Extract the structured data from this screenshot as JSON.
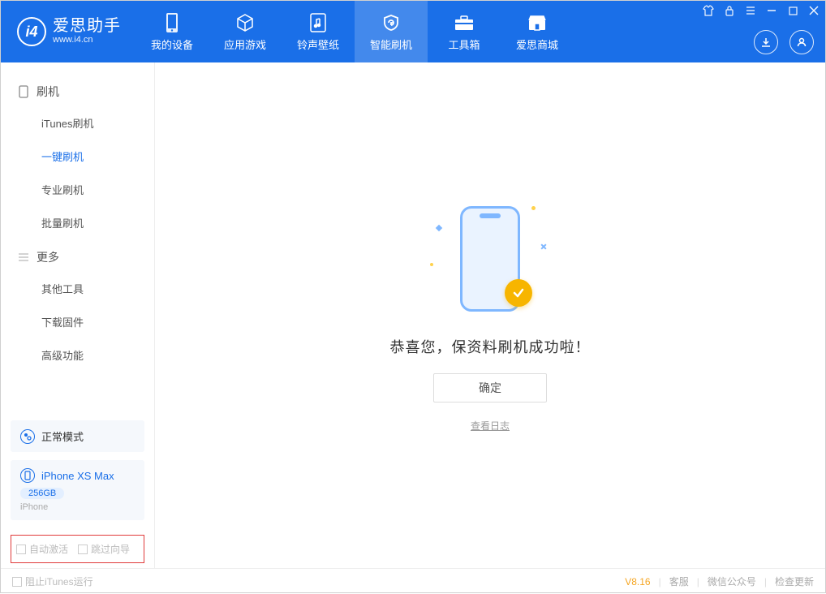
{
  "app": {
    "name": "爱思助手",
    "url": "www.i4.cn"
  },
  "nav": {
    "items": [
      {
        "label": "我的设备"
      },
      {
        "label": "应用游戏"
      },
      {
        "label": "铃声壁纸"
      },
      {
        "label": "智能刷机"
      },
      {
        "label": "工具箱"
      },
      {
        "label": "爱思商城"
      }
    ]
  },
  "sidebar": {
    "groups": [
      {
        "title": "刷机",
        "items": [
          "iTunes刷机",
          "一键刷机",
          "专业刷机",
          "批量刷机"
        ],
        "active_index": 1
      },
      {
        "title": "更多",
        "items": [
          "其他工具",
          "下载固件",
          "高级功能"
        ]
      }
    ],
    "mode_card": {
      "label": "正常模式"
    },
    "device_card": {
      "name": "iPhone XS Max",
      "storage": "256GB",
      "type": "iPhone"
    },
    "checks": {
      "auto_activate": "自动激活",
      "skip_guide": "跳过向导"
    }
  },
  "main": {
    "success_text": "恭喜您，保资料刷机成功啦！",
    "ok_label": "确定",
    "view_log": "查看日志"
  },
  "statusbar": {
    "block_itunes": "阻止iTunes运行",
    "version": "V8.16",
    "links": [
      "客服",
      "微信公众号",
      "检查更新"
    ]
  }
}
